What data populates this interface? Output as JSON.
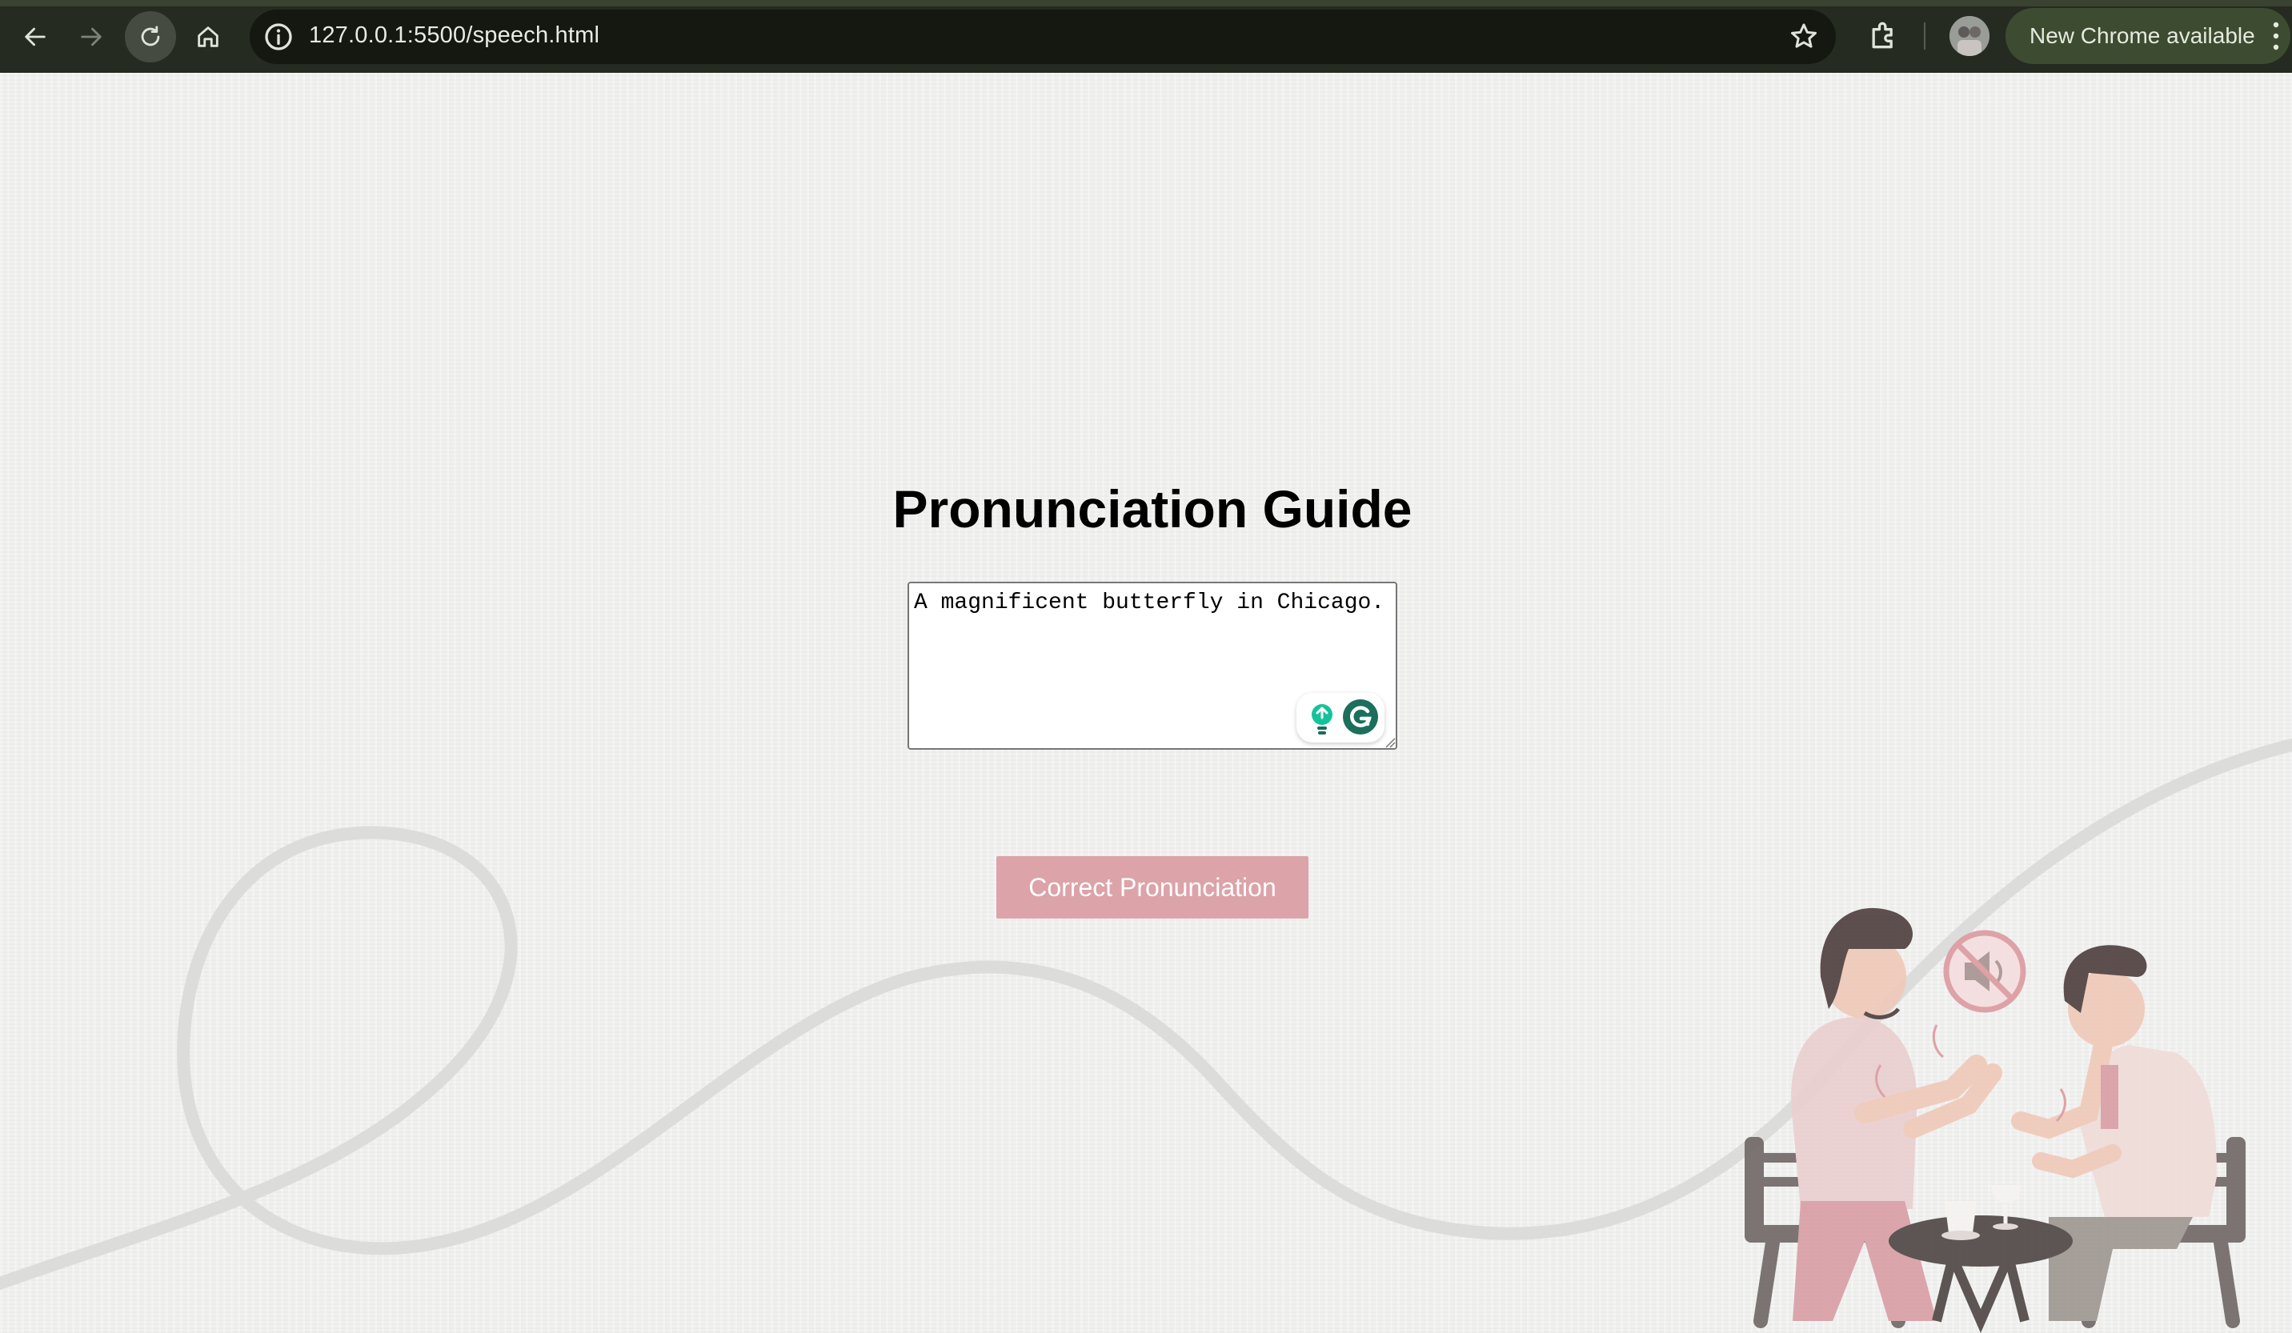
{
  "browser": {
    "url": "127.0.0.1:5500/speech.html",
    "update_label": "New Chrome available",
    "accent": "#3d4c31"
  },
  "page": {
    "title": "Pronunciation Guide",
    "textarea_value": "A magnificent butterfly in Chicago.",
    "button_label": "Correct Pronunciation",
    "button_color": "#dca3a9"
  }
}
